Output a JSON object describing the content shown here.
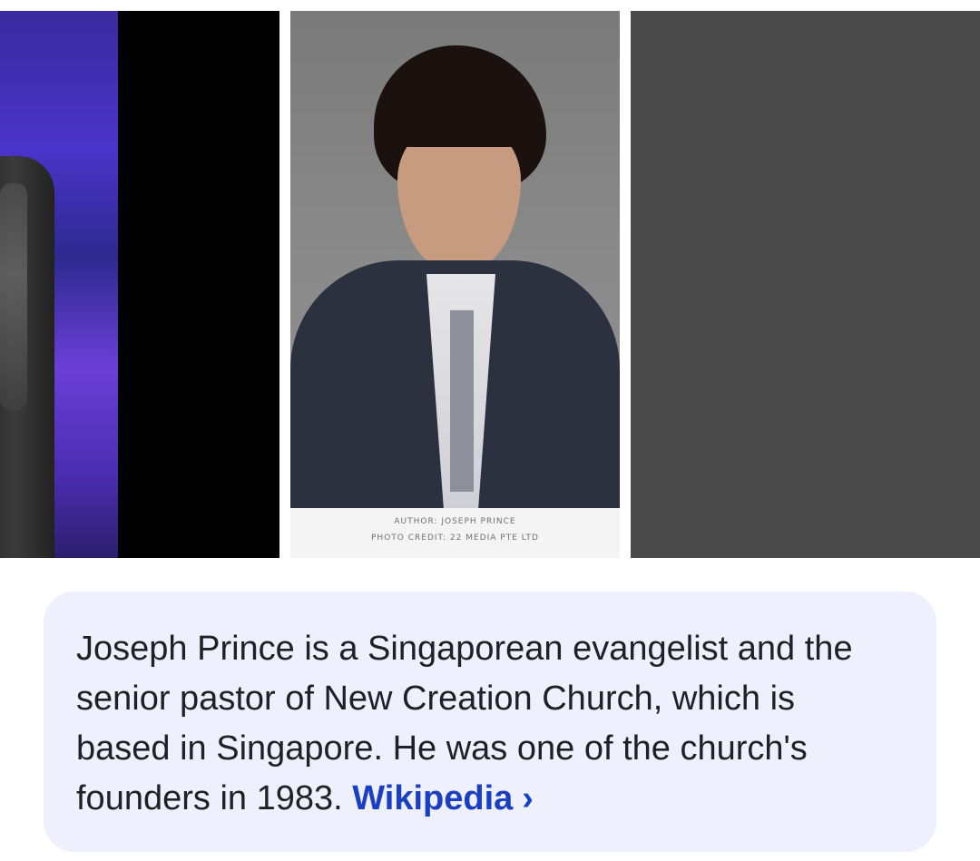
{
  "images": {
    "photo_caption_author": "AUTHOR: JOSEPH PRINCE",
    "photo_caption_credit": "PHOTO CREDIT: 22 MEDIA PTE LTD"
  },
  "description": {
    "text": "Joseph Prince is a Singaporean evangelist and the senior pastor of New Creation Church, which is based in Singapore. He was one of the church's founders in 1983.",
    "source_label": "Wikipedia",
    "source_icon": "chevron-right-icon"
  },
  "colors": {
    "card_background": "#eef0fe",
    "link": "#1a3fc2",
    "text": "#202124"
  }
}
